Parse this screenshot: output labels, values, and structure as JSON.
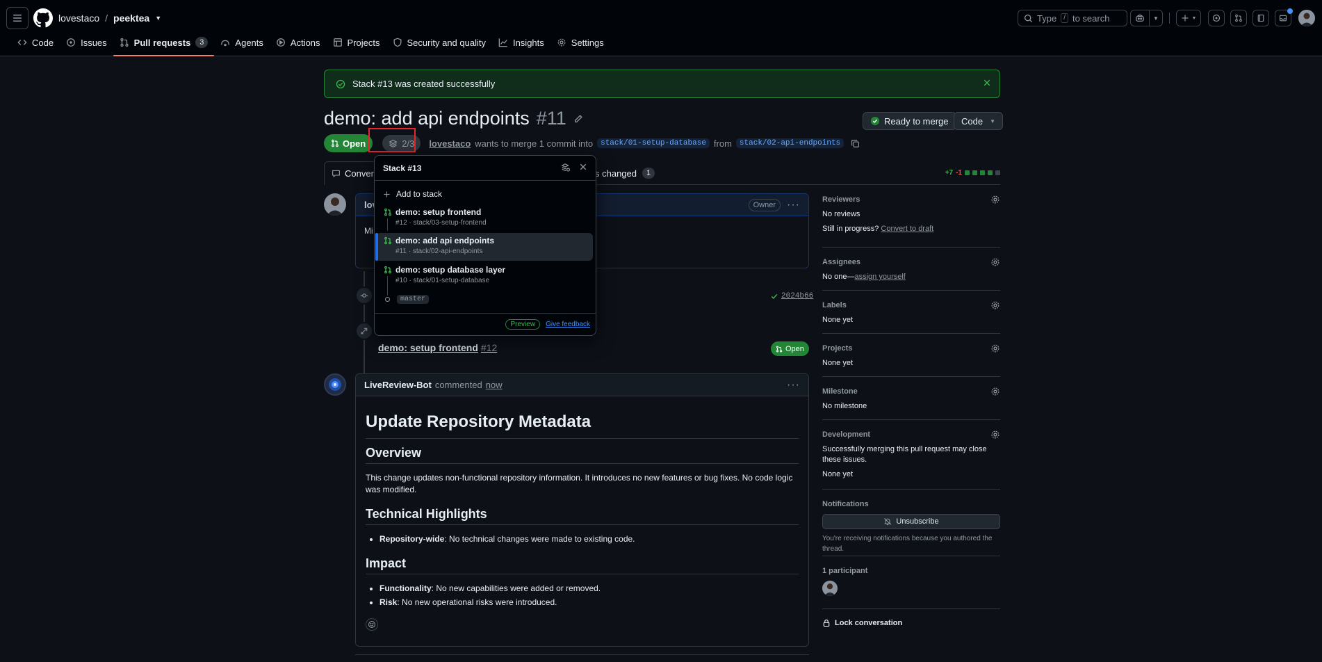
{
  "header": {
    "owner": "lovestaco",
    "separator": "/",
    "repo": "peektea",
    "search_prefix": "Type",
    "search_key": "/",
    "search_suffix": "to search"
  },
  "nav": [
    {
      "label": "Code",
      "icon": "code-icon"
    },
    {
      "label": "Issues",
      "icon": "issue-icon"
    },
    {
      "label": "Pull requests",
      "icon": "pr-icon",
      "count": "3",
      "active": true
    },
    {
      "label": "Agents",
      "icon": "agent-icon"
    },
    {
      "label": "Actions",
      "icon": "play-icon"
    },
    {
      "label": "Projects",
      "icon": "table-icon"
    },
    {
      "label": "Security and quality",
      "icon": "shield-icon"
    },
    {
      "label": "Insights",
      "icon": "graph-icon"
    },
    {
      "label": "Settings",
      "icon": "gear-icon"
    }
  ],
  "flash": {
    "message": "Stack #13 was created successfully"
  },
  "pr": {
    "title": "demo: add api endpoints",
    "number": "#11",
    "state": "Open",
    "stack_pos": "2/3",
    "author": "lovestaco",
    "merge_text": "wants to merge 1 commit into",
    "base": "stack/01-setup-database",
    "from": "from",
    "head": "stack/02-api-endpoints",
    "ready_label": "Ready to merge",
    "code_label": "Code"
  },
  "tabs": {
    "conversation": "Convers",
    "files": "s changed",
    "files_count": "1",
    "additions": "+7",
    "deletions": "-1"
  },
  "comment1": {
    "author_visible": "lov",
    "owner": "Owner",
    "body_visible": "Mi"
  },
  "timeline": {
    "sha": "2024b66",
    "stack_pr_title": "demo: setup frontend",
    "stack_pr_num": "#12",
    "stack_pr_state": "Open"
  },
  "bot_comment": {
    "author": "LiveReview-Bot",
    "action": "commented",
    "time": "now",
    "h1": "Update Repository Metadata",
    "h2_overview": "Overview",
    "overview_text": "This change updates non-functional repository information. It introduces no new features or bug fixes. No code logic was modified.",
    "h2_tech": "Technical Highlights",
    "tech_items": [
      {
        "label": "Repository-wide",
        "text": ": No technical changes were made to existing code."
      }
    ],
    "h2_impact": "Impact",
    "impact_items": [
      {
        "label": "Functionality",
        "text": ": No new capabilities were added or removed."
      },
      {
        "label": "Risk",
        "text": ": No new operational risks were introduced."
      }
    ]
  },
  "sidebar": {
    "reviewers": {
      "title": "Reviewers",
      "value": "No reviews",
      "progress": "Still in progress?",
      "draft": "Convert to draft"
    },
    "assignees": {
      "title": "Assignees",
      "value": "No one—",
      "assign": "assign yourself"
    },
    "labels": {
      "title": "Labels",
      "value": "None yet"
    },
    "projects": {
      "title": "Projects",
      "value": "None yet"
    },
    "milestone": {
      "title": "Milestone",
      "value": "No milestone"
    },
    "development": {
      "title": "Development",
      "desc": "Successfully merging this pull request may close these issues.",
      "value": "None yet"
    },
    "notifications": {
      "title": "Notifications",
      "button": "Unsubscribe",
      "note": "You're receiving notifications because you authored the thread."
    },
    "participants": {
      "title": "1 participant"
    },
    "lock": "Lock conversation"
  },
  "popover": {
    "title": "Stack #13",
    "add": "Add to stack",
    "items": [
      {
        "title": "demo: setup frontend",
        "sub": "#12 · stack/03-setup-frontend"
      },
      {
        "title": "demo: add api endpoints",
        "sub": "#11 · stack/02-api-endpoints"
      },
      {
        "title": "demo: setup database layer",
        "sub": "#10 · stack/01-setup-database"
      }
    ],
    "master": "master",
    "preview": "Preview",
    "feedback": "Give feedback"
  }
}
